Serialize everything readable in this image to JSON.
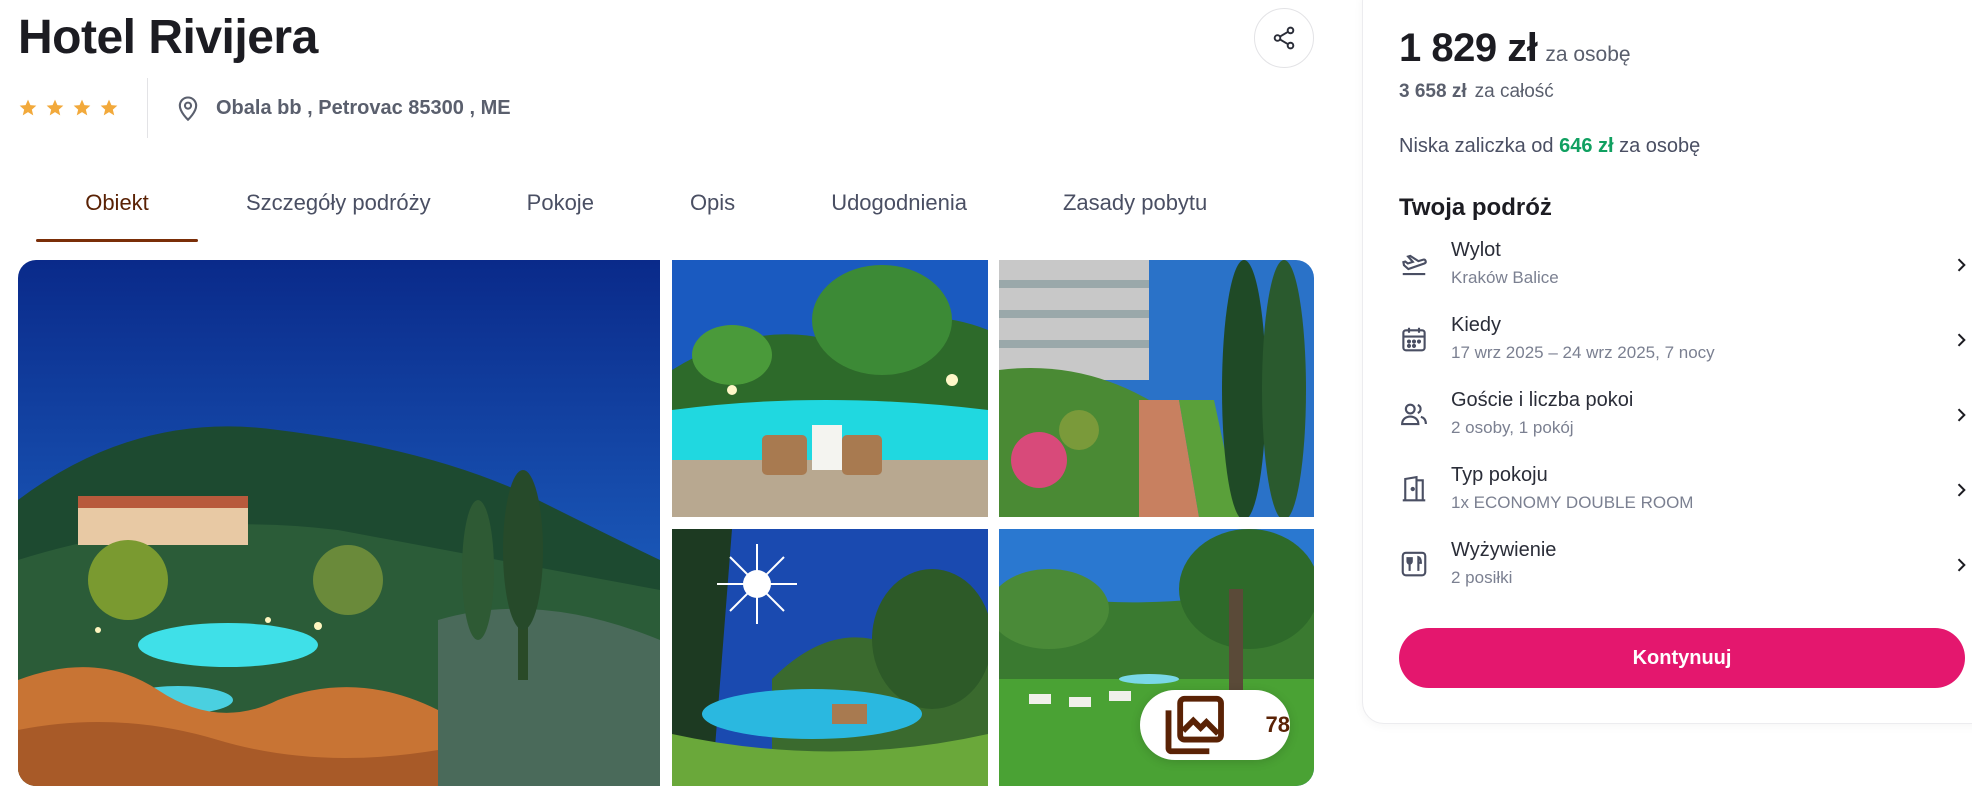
{
  "hotel": {
    "name": "Hotel Rivijera",
    "stars": 4,
    "address": "Obala bb , Petrovac 85300 , ME"
  },
  "tabs": [
    {
      "label": "Obiekt",
      "active": true
    },
    {
      "label": "Szczegóły podróży",
      "active": false
    },
    {
      "label": "Pokoje",
      "active": false
    },
    {
      "label": "Opis",
      "active": false
    },
    {
      "label": "Udogodnienia",
      "active": false
    },
    {
      "label": "Zasady pobytu",
      "active": false
    }
  ],
  "gallery": {
    "photo_count": "78"
  },
  "pricing": {
    "per_person": "1 829 zł",
    "per_person_unit": "za osobę",
    "total": "3 658 zł",
    "total_unit": "za całość",
    "deposit_prefix": "Niska zaliczka od",
    "deposit_amount": "646 zł",
    "deposit_suffix": "za osobę"
  },
  "trip": {
    "title": "Twoja podróż",
    "items": [
      {
        "label": "Wylot",
        "value": "Kraków Balice",
        "icon": "plane-departure-icon"
      },
      {
        "label": "Kiedy",
        "value": "17 wrz 2025 – 24 wrz 2025, 7 nocy",
        "icon": "calendar-icon"
      },
      {
        "label": "Goście i liczba pokoi",
        "value": "2 osoby, 1 pokój",
        "icon": "guests-icon"
      },
      {
        "label": "Typ pokoju",
        "value": "1x ECONOMY DOUBLE ROOM",
        "icon": "door-icon"
      },
      {
        "label": "Wyżywienie",
        "value": "2 posiłki",
        "icon": "meal-icon"
      }
    ]
  },
  "cta": {
    "label": "Kontynuuj"
  },
  "colors": {
    "accent": "#e4176e",
    "tab_active": "#5a2205",
    "star": "#f2a93b",
    "deposit_green": "#10a060"
  }
}
